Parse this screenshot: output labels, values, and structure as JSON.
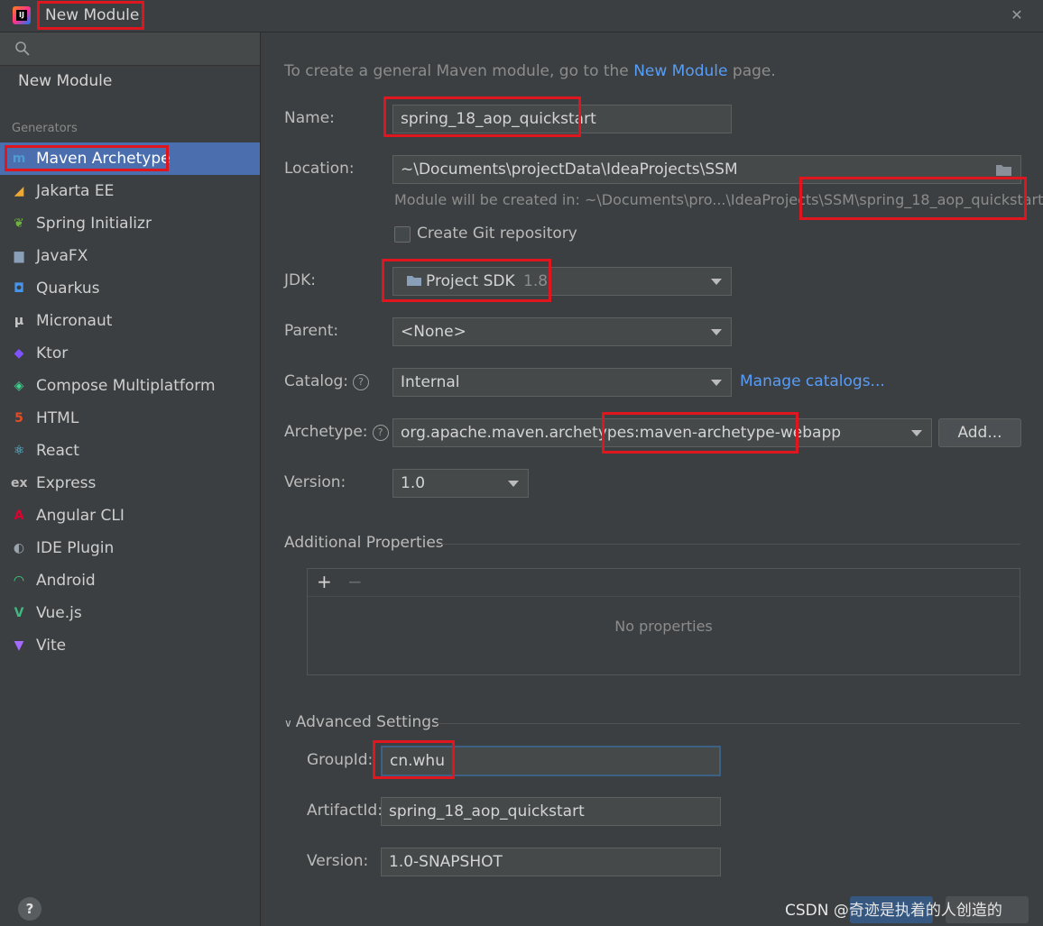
{
  "window": {
    "title": "New Module",
    "close_glyph": "✕"
  },
  "sidebar": {
    "search_placeholder": "",
    "new_module_label": "New Module",
    "generators_header": "Generators",
    "items": [
      {
        "label": "Maven Archetype",
        "icon": "maven-icon",
        "glyph": "m",
        "color": "#4e9bd1",
        "selected": true
      },
      {
        "label": "Jakarta EE",
        "icon": "jakarta-icon",
        "glyph": "◢",
        "color": "#f0a830"
      },
      {
        "label": "Spring Initializr",
        "icon": "spring-icon",
        "glyph": "❦",
        "color": "#6db33f"
      },
      {
        "label": "JavaFX",
        "icon": "folder-icon",
        "glyph": "▆",
        "color": "#8aa0b8"
      },
      {
        "label": "Quarkus",
        "icon": "quarkus-icon",
        "glyph": "◘",
        "color": "#4695eb"
      },
      {
        "label": "Micronaut",
        "icon": "micronaut-icon",
        "glyph": "μ",
        "color": "#c8c8c8"
      },
      {
        "label": "Ktor",
        "icon": "ktor-icon",
        "glyph": "◆",
        "color": "#7f52ff"
      },
      {
        "label": "Compose Multiplatform",
        "icon": "compose-icon",
        "glyph": "◈",
        "color": "#3fcf8e"
      },
      {
        "label": "HTML",
        "icon": "html5-icon",
        "glyph": "5",
        "color": "#e44d26"
      },
      {
        "label": "React",
        "icon": "react-icon",
        "glyph": "⚛",
        "color": "#61dafb"
      },
      {
        "label": "Express",
        "icon": "express-icon",
        "glyph": "ex",
        "color": "#bbbbbb"
      },
      {
        "label": "Angular CLI",
        "icon": "angular-icon",
        "glyph": "A",
        "color": "#dd0031"
      },
      {
        "label": "IDE Plugin",
        "icon": "plugin-icon",
        "glyph": "◐",
        "color": "#9aa4ad"
      },
      {
        "label": "Android",
        "icon": "android-icon",
        "glyph": "◠",
        "color": "#3ddc84"
      },
      {
        "label": "Vue.js",
        "icon": "vue-icon",
        "glyph": "V",
        "color": "#41b883"
      },
      {
        "label": "Vite",
        "icon": "vite-icon",
        "glyph": "▼",
        "color": "#a56bff"
      }
    ],
    "help_label": "?"
  },
  "main": {
    "intro_text": "To create a general Maven module, go to the",
    "intro_link": "New Module",
    "intro_suffix": "page.",
    "name_label": "Name:",
    "name_value": "spring_18_aop_quickstart",
    "location_label": "Location:",
    "location_value": "~\\Documents\\projectData\\IdeaProjects\\SSM",
    "module_hint": "Module will be created in: ~\\Documents\\pro...\\IdeaProjects\\SSM\\spring_18_aop_quickstart",
    "git_label": "Create Git repository",
    "git_checked": false,
    "jdk_label": "JDK:",
    "jdk_value": "Project SDK",
    "jdk_version": "1.8",
    "parent_label": "Parent:",
    "parent_value": "<None>",
    "catalog_label": "Catalog:",
    "catalog_value": "Internal",
    "manage_catalogs": "Manage catalogs...",
    "archetype_label": "Archetype:",
    "archetype_value": "org.apache.maven.archetypes:maven-archetype-webapp",
    "add_button": "Add...",
    "version_label": "Version:",
    "version_value": "1.0",
    "additional_properties": "Additional Properties",
    "add_prop": "+",
    "remove_prop": "−",
    "no_properties": "No properties",
    "advanced_settings": "Advanced Settings",
    "groupid_label": "GroupId:",
    "groupid_value": "cn.whu",
    "artifactid_label": "ArtifactId:",
    "artifactid_value": "spring_18_aop_quickstart",
    "adv_version_label": "Version:",
    "adv_version_value": "1.0-SNAPSHOT"
  },
  "watermark": "CSDN @奇迹是执着的人创造的",
  "colors": {
    "highlight_red": "#e0161f",
    "selection": "#4b6eaf",
    "link": "#589df6"
  }
}
